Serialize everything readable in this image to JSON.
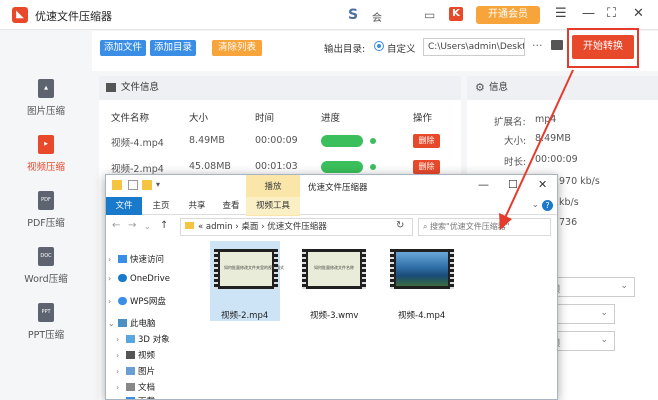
{
  "app": {
    "title": "优速文件压缩器",
    "meeting": "会",
    "vip_label": "开通会员",
    "k_badge": "K"
  },
  "window_controls": {
    "menu": "☰",
    "minimize": "—",
    "maximize": "⛶",
    "close": "✕"
  },
  "sidebar": {
    "items": [
      {
        "label": "图片压缩",
        "icon": "image-file-icon",
        "icon_text": "",
        "active": false
      },
      {
        "label": "视频压缩",
        "icon": "video-file-icon",
        "icon_text": "",
        "active": true
      },
      {
        "label": "PDF压缩",
        "icon": "pdf-file-icon",
        "icon_text": "PDF",
        "active": false
      },
      {
        "label": "Word压缩",
        "icon": "doc-file-icon",
        "icon_text": "DOC",
        "active": false
      },
      {
        "label": "PPT压缩",
        "icon": "ppt-file-icon",
        "icon_text": "PPT",
        "active": false
      }
    ]
  },
  "toolbar": {
    "add_file": "添加文件",
    "add_folder": "添加目录",
    "clear_list": "清除列表",
    "output_label": "输出目录:",
    "custom_label": "自定义",
    "output_path": "C:\\Users\\admin\\Deskto",
    "dots": "···",
    "start": "开始转换"
  },
  "file_panel": {
    "title": "文件信息",
    "columns": [
      "文件名称",
      "大小",
      "时间",
      "进度",
      "操作"
    ],
    "rows": [
      {
        "name": "视频-4.mp4",
        "size": "8.49MB",
        "time": "00:00:09",
        "action": "删除"
      },
      {
        "name": "视频-2.mp4",
        "size": "45.08MB",
        "time": "00:01:03",
        "action": "删除"
      }
    ]
  },
  "info_panel": {
    "title": "信息",
    "rows": [
      {
        "label": "扩展名:",
        "value": "mp4"
      },
      {
        "label": "大小:",
        "value": "8.49MB"
      },
      {
        "label": "时长:",
        "value": "00:00:09"
      },
      {
        "label": "",
        "value": "970 kb/s"
      },
      {
        "label": "",
        "value": "kb/s"
      },
      {
        "label": "",
        "value": "736"
      }
    ],
    "selects": [
      "视频",
      "",
      "视频"
    ]
  },
  "explorer": {
    "title": "优速文件压缩器",
    "tabs": {
      "file": "文件",
      "home": "主页",
      "share": "共享",
      "view": "查看",
      "play": "播放",
      "video_tools": "视频工具"
    },
    "address": {
      "seg1": "«",
      "seg2": "admin",
      "seg3": "桌面",
      "seg4": "优速文件压缩器",
      "sep": "›"
    },
    "search_placeholder": "搜索\"优速文件压缩器\"",
    "nav": [
      {
        "label": "快速访问",
        "icon": "star-icon",
        "color": "#3a8ee6",
        "expanded": false
      },
      {
        "label": "OneDrive",
        "icon": "cloud-icon",
        "color": "#1979ca",
        "expanded": false
      },
      {
        "label": "WPS网盘",
        "icon": "wps-cloud-icon",
        "color": "#3a8ee6",
        "expanded": false
      },
      {
        "label": "此电脑",
        "icon": "computer-icon",
        "color": "#4a90c2",
        "expanded": true
      },
      {
        "label": "3D 对象",
        "icon": "cube-icon",
        "color": "#5aa7e0",
        "expanded": false
      },
      {
        "label": "视频",
        "icon": "video-folder-icon",
        "color": "#555",
        "expanded": false
      },
      {
        "label": "图片",
        "icon": "picture-folder-icon",
        "color": "#6a9fd4",
        "expanded": false
      },
      {
        "label": "文档",
        "icon": "document-folder-icon",
        "color": "#888",
        "expanded": false
      },
      {
        "label": "下载",
        "icon": "download-folder-icon",
        "color": "#3a8ee6",
        "expanded": false
      }
    ],
    "files": [
      {
        "name": "视频-2.mp4",
        "selected": true,
        "thumb_text": "如何批量修改文件夹里的视频格式",
        "thumb": "slide"
      },
      {
        "name": "视频-3.wmv",
        "selected": false,
        "thumb_text": "如何批量修改文件名称",
        "thumb": "slide"
      },
      {
        "name": "视频-4.mp4",
        "selected": false,
        "thumb_text": "",
        "thumb": "coast"
      }
    ]
  },
  "colors": {
    "brand_red": "#e8492b",
    "blue": "#3a8ee6",
    "orange": "#f7a43a",
    "progress_green": "#3bbf5c",
    "arrow_red": "#e53b2c"
  }
}
